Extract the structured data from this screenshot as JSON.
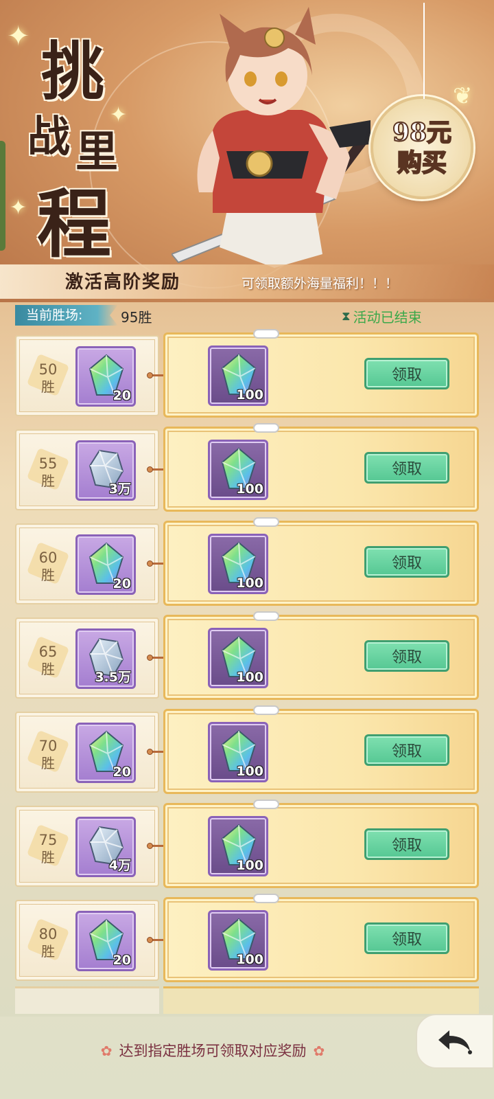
{
  "banner": {
    "title_chars": [
      "挑",
      "战",
      "里",
      "程"
    ],
    "price_line1": "98元",
    "price_line2": "购买",
    "subtitle_main": "激活高阶奖励",
    "subtitle_sub": "可领取额外海量福利！！！"
  },
  "status": {
    "wins_label": "当前胜场:",
    "wins_value": "95胜",
    "event_status": "活动已结束"
  },
  "rewards": [
    {
      "wins": "50",
      "unit": "胜",
      "free_count": "20",
      "free_item": "rainbow-crystal-icon",
      "premium_count": "100",
      "claim_label": "领取"
    },
    {
      "wins": "55",
      "unit": "胜",
      "free_count": "3万",
      "free_item": "silver-ore-icon",
      "premium_count": "100",
      "claim_label": "领取"
    },
    {
      "wins": "60",
      "unit": "胜",
      "free_count": "20",
      "free_item": "rainbow-crystal-icon",
      "premium_count": "100",
      "claim_label": "领取"
    },
    {
      "wins": "65",
      "unit": "胜",
      "free_count": "3.5万",
      "free_item": "silver-ore-icon",
      "premium_count": "100",
      "claim_label": "领取"
    },
    {
      "wins": "70",
      "unit": "胜",
      "free_count": "20",
      "free_item": "rainbow-crystal-icon",
      "premium_count": "100",
      "claim_label": "领取"
    },
    {
      "wins": "75",
      "unit": "胜",
      "free_count": "4万",
      "free_item": "silver-ore-icon",
      "premium_count": "100",
      "claim_label": "领取"
    },
    {
      "wins": "80",
      "unit": "胜",
      "free_count": "20",
      "free_item": "rainbow-crystal-icon",
      "premium_count": "100",
      "claim_label": "领取"
    }
  ],
  "footer": {
    "note": "达到指定胜场可领取对应奖励"
  },
  "colors": {
    "claim_button": "#55c793",
    "event_ended": "#3aa84a",
    "premium_card_border": "#e8b85a"
  }
}
